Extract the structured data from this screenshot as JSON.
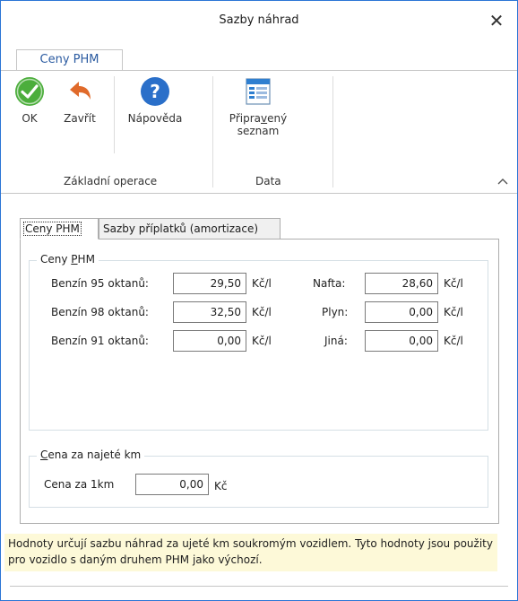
{
  "window": {
    "title": "Sazby náhrad"
  },
  "ribbon": {
    "tab": "Ceny PHM",
    "buttons": {
      "ok": "OK",
      "close": "Zavřít",
      "help": "Nápověda",
      "prepared_line1_pre": "Připra",
      "prepared_line1_ul": "v",
      "prepared_line1_post": "ený",
      "prepared_line2": "seznam"
    },
    "groups": {
      "basic": "Základní operace",
      "data": "Data"
    }
  },
  "tabs": {
    "fuel_prices": "Ceny PHM",
    "surcharges": "Sazby příplatků (amortizace)"
  },
  "fuel_group": {
    "title_pre": "Ceny ",
    "title_ul": "P",
    "title_post": "HM",
    "rows": [
      {
        "label": "Benzín 95 oktanů:",
        "value": "29,50",
        "unit": "Kč/l"
      },
      {
        "label": "Benzín 98 oktanů:",
        "value": "32,50",
        "unit": "Kč/l"
      },
      {
        "label": "Benzín 91 oktanů:",
        "value": "0,00",
        "unit": "Kč/l"
      },
      {
        "label": "Nafta:",
        "value": "28,60",
        "unit": "Kč/l"
      },
      {
        "label": "Plyn:",
        "value": "0,00",
        "unit": "Kč/l"
      },
      {
        "label": "Jiná:",
        "value": "0,00",
        "unit": "Kč/l"
      }
    ]
  },
  "km_group": {
    "title_ul": "C",
    "title_post": "ena za najeté km",
    "label": "Cena za 1km",
    "value": "0,00",
    "unit": "Kč"
  },
  "info": "Hodnoty určují sazbu náhrad za ujeté km soukromým vozidlem. Tyto hodnoty jsou použity pro vozidlo s daným druhem PHM jako výchozí.",
  "colors": {
    "accent": "#2b75d6",
    "ok_green": "#4cae3c",
    "help_blue": "#2a6fc9",
    "info_bg": "#fdf9d8"
  }
}
